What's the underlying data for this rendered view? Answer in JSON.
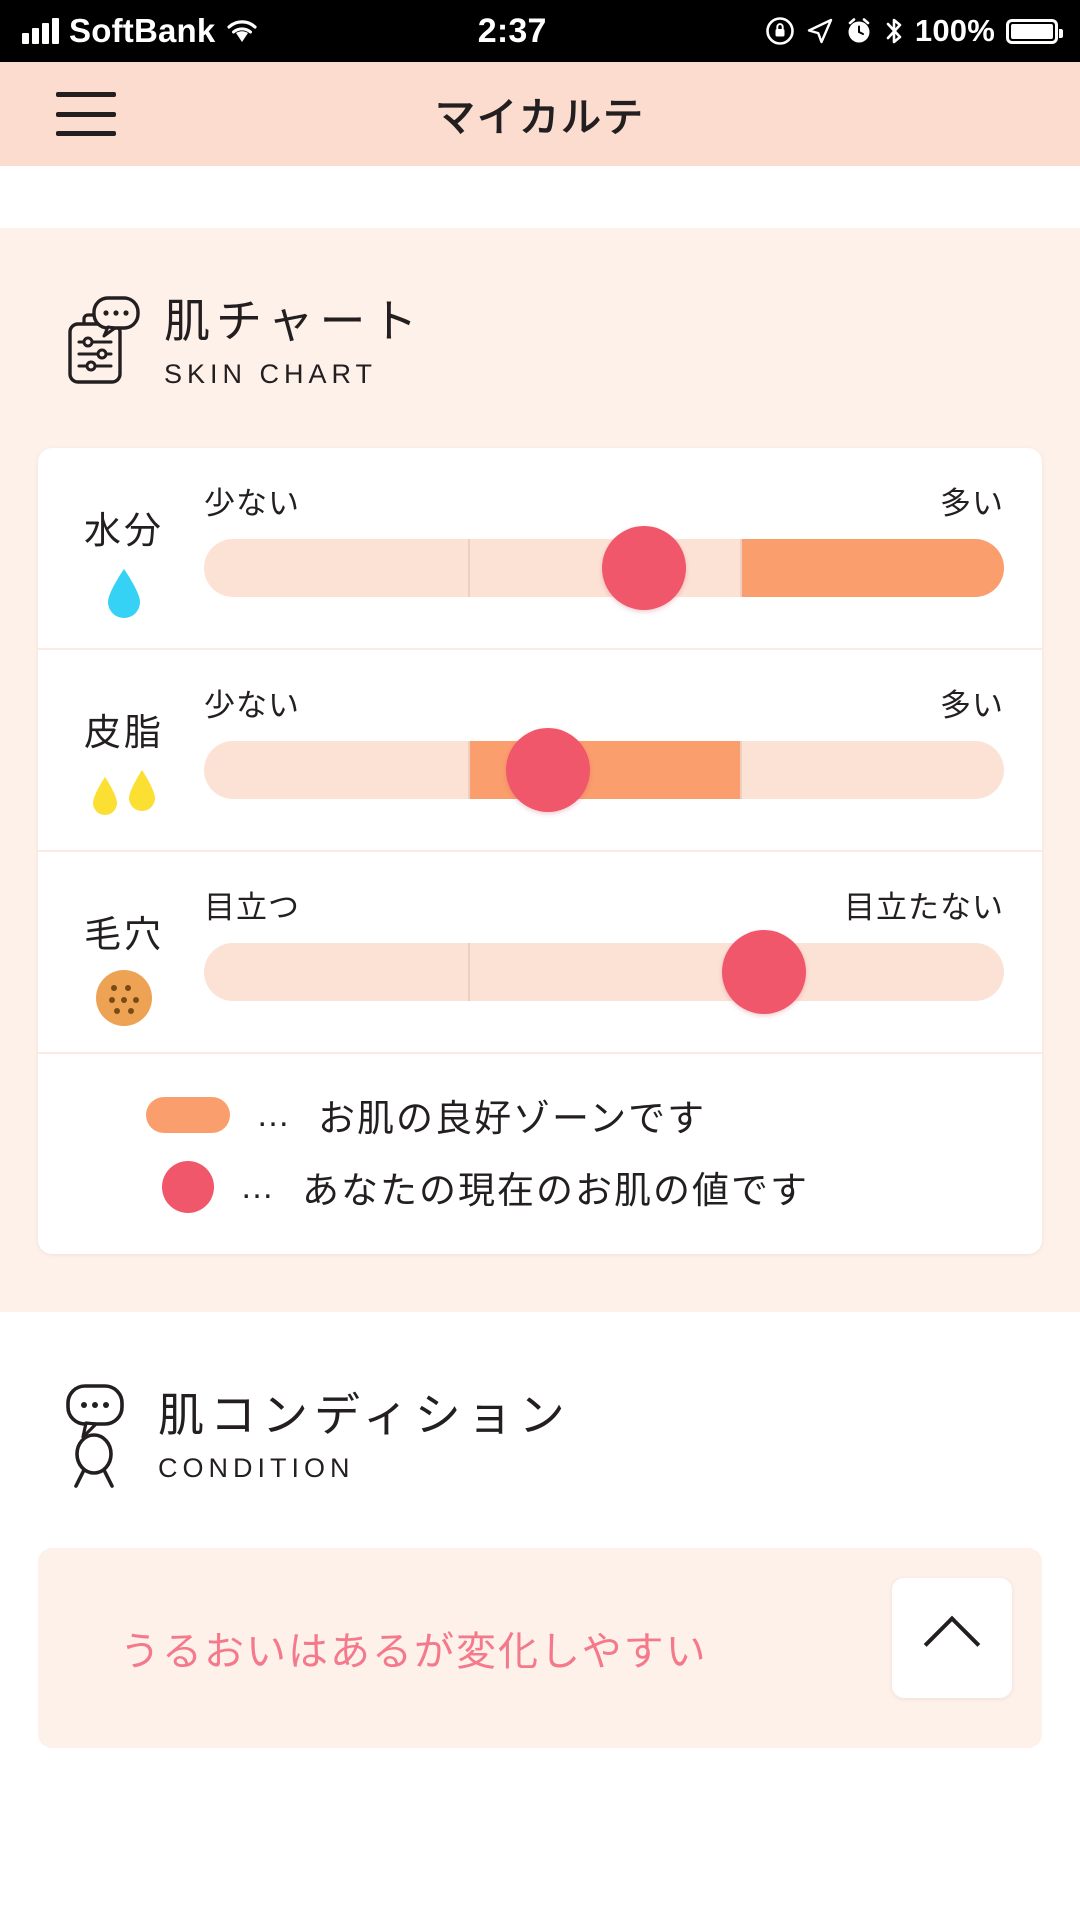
{
  "status_bar": {
    "carrier": "SoftBank",
    "time": "2:37",
    "battery_percent": "100%",
    "icons": [
      "signal-bars-icon",
      "wifi-icon",
      "rotation-lock-icon",
      "location-arrow-icon",
      "alarm-clock-icon",
      "bluetooth-icon",
      "battery-icon"
    ]
  },
  "app_bar": {
    "menu_icon": "hamburger-menu-icon",
    "title": "マイカルテ"
  },
  "skin_chart": {
    "icon": "clipboard-chat-icon",
    "title_jp": "肌チャート",
    "title_en": "SKIN CHART",
    "rows": [
      {
        "name": "水分",
        "icon": "water-drop-icon",
        "left_label": "少ない",
        "right_label": "多い",
        "marker_percent": 55,
        "zone_start_percent": 67,
        "zone_end_percent": 100,
        "ticks": [
          33,
          67
        ]
      },
      {
        "name": "皮脂",
        "icon": "two-oil-drops-icon",
        "left_label": "少ない",
        "right_label": "多い",
        "marker_percent": 43,
        "zone_start_percent": 33,
        "zone_end_percent": 67,
        "ticks": [
          33,
          67
        ]
      },
      {
        "name": "毛穴",
        "icon": "pore-circle-icon",
        "left_label": "目立つ",
        "right_label": "目立たない",
        "marker_percent": 70,
        "zone_start_percent": 0,
        "zone_end_percent": 0,
        "ticks": [
          33
        ]
      }
    ],
    "legend": [
      {
        "swatch": "zone-bar",
        "dots": "…",
        "text": "お肌の良好ゾーンです"
      },
      {
        "swatch": "value-dot",
        "dots": "…",
        "text": "あなたの現在のお肌の値です"
      }
    ]
  },
  "condition": {
    "icon": "person-chat-icon",
    "title_jp": "肌コンディション",
    "title_en": "CONDITION",
    "summary_text": "うるおいはあるが変化しやすい",
    "collapse_icon": "chevron-up-icon"
  },
  "colors": {
    "header_bg": "#fbdcce",
    "section_bg": "#fdf1ea",
    "track": "#fce2d5",
    "good_zone": "#fb9e6d",
    "marker": "#f0576a",
    "condition_text": "#f4798b",
    "water_drop": "#36d2f5",
    "oil_drop": "#fbe033",
    "pore": "#eda254"
  },
  "chart_data": {
    "type": "bar",
    "title": "肌チャート / SKIN CHART",
    "categories": [
      "水分",
      "皮脂",
      "毛穴"
    ],
    "values": [
      55,
      43,
      70
    ],
    "xlabel": "",
    "ylabel": "",
    "ylim": [
      0,
      100
    ],
    "series": [
      {
        "name": "あなたの現在のお肌の値です",
        "values": [
          55,
          43,
          70
        ]
      }
    ],
    "zones": [
      {
        "category": "水分",
        "good_zone": [
          67,
          100
        ]
      },
      {
        "category": "皮脂",
        "good_zone": [
          33,
          67
        ]
      },
      {
        "category": "毛穴",
        "good_zone": [
          0,
          0
        ]
      }
    ],
    "axis_labels": [
      {
        "category": "水分",
        "left": "少ない",
        "right": "多い"
      },
      {
        "category": "皮脂",
        "left": "少ない",
        "right": "多い"
      },
      {
        "category": "毛穴",
        "left": "目立つ",
        "right": "目立たない"
      }
    ],
    "legend": [
      "お肌の良好ゾーンです",
      "あなたの現在のお肌の値です"
    ],
    "grid": false,
    "legend_position": "bottom"
  }
}
